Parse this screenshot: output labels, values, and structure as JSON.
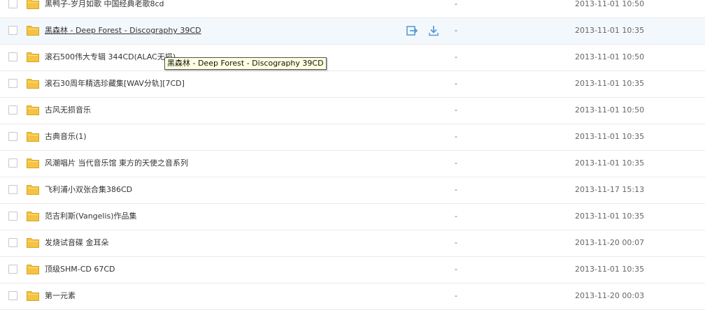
{
  "files": [
    {
      "name": "黑鸭子-岁月如歌 中国经典老歌8cd",
      "size": "-",
      "date": "2013-11-01 10:50"
    },
    {
      "name": "黑森林 - Deep Forest - Discography 39CD",
      "size": "-",
      "date": "2013-11-01 10:35",
      "hovered": true
    },
    {
      "name": "滚石500伟大专辑 344CD(ALAC无损)",
      "size": "-",
      "date": "2013-11-01 10:50"
    },
    {
      "name": "滚石30周年精选珍藏集[WAV分轨][7CD]",
      "size": "-",
      "date": "2013-11-01 10:35"
    },
    {
      "name": "古风无损音乐",
      "size": "-",
      "date": "2013-11-01 10:50"
    },
    {
      "name": "古典音乐(1)",
      "size": "-",
      "date": "2013-11-01 10:35"
    },
    {
      "name": "风潮唱片 当代音乐馆 東方的天使之音系列",
      "size": "-",
      "date": "2013-11-01 10:35"
    },
    {
      "name": "飞利浦小双张合集386CD",
      "size": "-",
      "date": "2013-11-17 15:13"
    },
    {
      "name": "范吉利斯(Vangelis)作品集",
      "size": "-",
      "date": "2013-11-01 10:35"
    },
    {
      "name": "发烧试音碟 金耳朵",
      "size": "-",
      "date": "2013-11-20 00:07"
    },
    {
      "name": "顶级SHM-CD 67CD",
      "size": "-",
      "date": "2013-11-01 10:35"
    },
    {
      "name": "第一元素",
      "size": "-",
      "date": "2013-11-20 00:03"
    }
  ],
  "tooltip": "黑森林 - Deep Forest - Discography 39CD",
  "icons": {
    "folder": "folder-icon",
    "share": "share-icon",
    "download": "download-icon"
  },
  "colors": {
    "folder": "#f5c342",
    "action": "#5b9bd5",
    "hover_row": "#f3f8fd"
  }
}
